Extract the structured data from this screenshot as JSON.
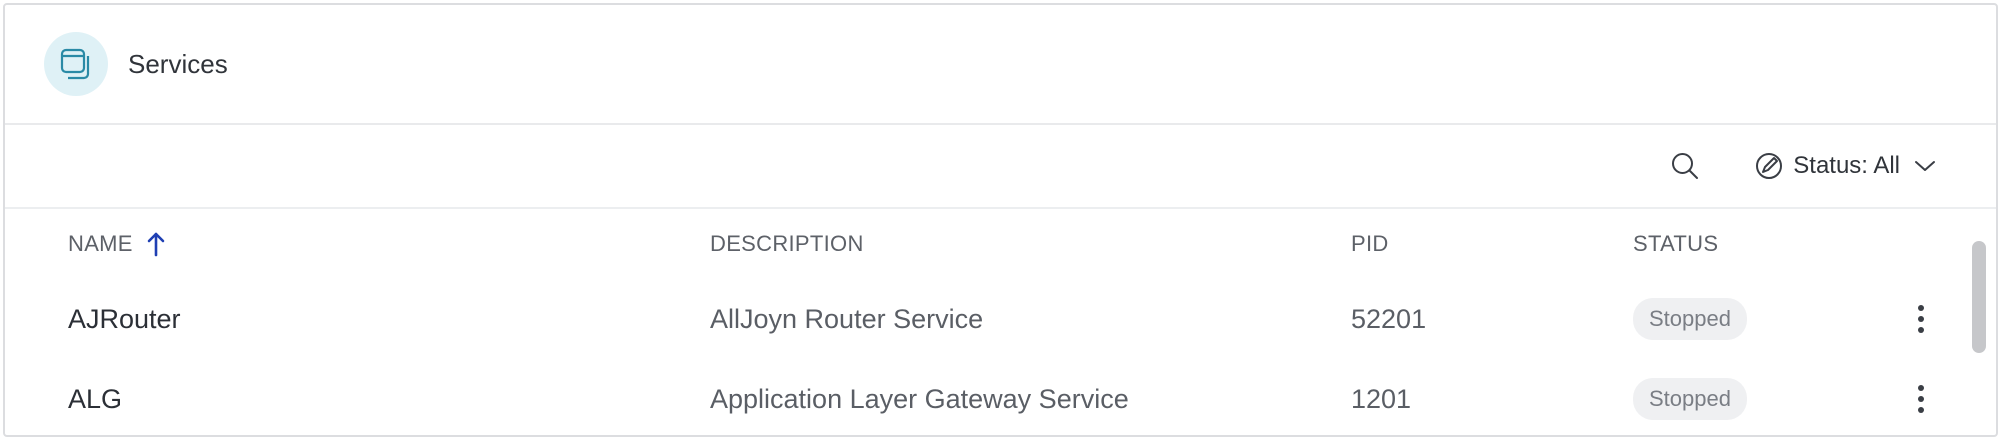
{
  "header": {
    "title": "Services",
    "icon": "services-icon"
  },
  "toolbar": {
    "search_icon": "search-icon",
    "status_filter": {
      "label": "Status: All",
      "icon": "filter-icon",
      "dropdown_icon": "chevron-down-icon"
    }
  },
  "table": {
    "columns": [
      {
        "label": "NAME",
        "sort": "ascending"
      },
      {
        "label": "DESCRIPTION"
      },
      {
        "label": "PID"
      },
      {
        "label": "STATUS"
      }
    ],
    "rows": [
      {
        "name": "AJRouter",
        "description": "AllJoyn Router Service",
        "pid": "52201",
        "status": "Stopped"
      },
      {
        "name": "ALG",
        "description": "Application Layer Gateway Service",
        "pid": "1201",
        "status": "Stopped"
      }
    ]
  },
  "colors": {
    "accent": "#1f3fb3",
    "icon_bg": "#dff1f6",
    "icon_stroke": "#2a8aa6",
    "badge_bg": "#eff0f2"
  }
}
